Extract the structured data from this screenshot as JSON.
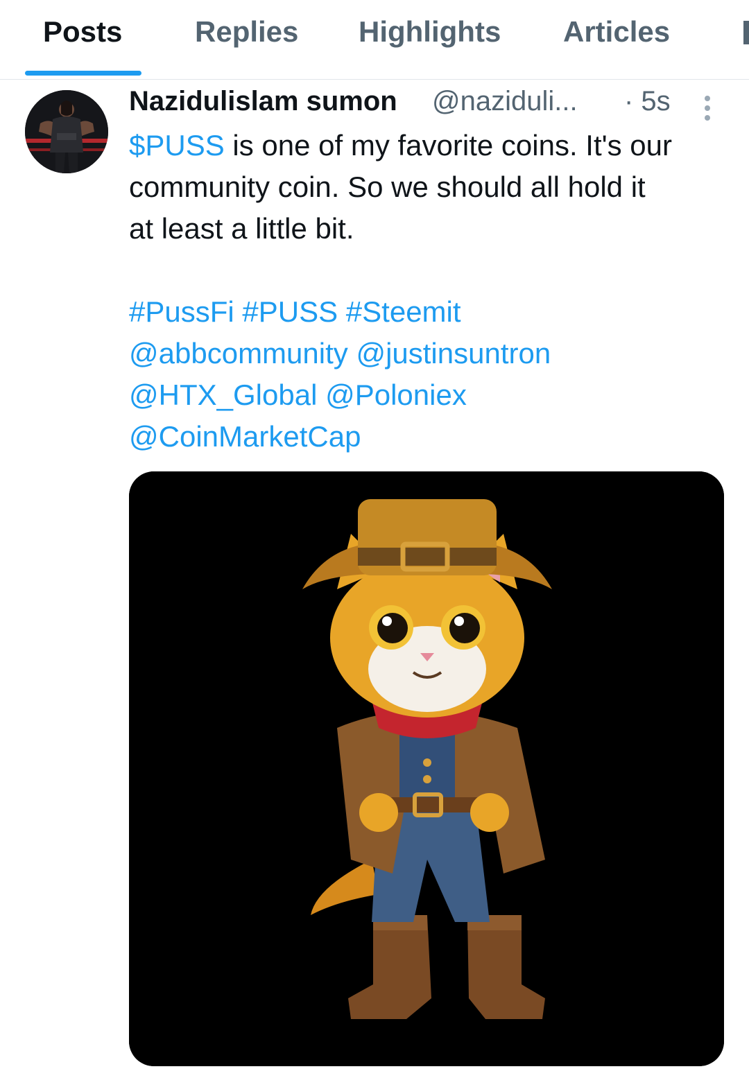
{
  "tabs": [
    {
      "label": "Posts",
      "active": true
    },
    {
      "label": "Replies",
      "active": false
    },
    {
      "label": "Highlights",
      "active": false
    },
    {
      "label": "Articles",
      "active": false
    }
  ],
  "post": {
    "author_name": "Nazidulislam sumon",
    "author_handle": "@naziduli...",
    "timestamp": "· 5s",
    "cashtag": "$PUSS",
    "text_line1_rest": " is one of my favorite coins. It's our",
    "text_line2": "community coin. So we should all hold it",
    "text_line3": "at least a little bit.",
    "hashtags": [
      "#PussFi",
      "#PUSS",
      "#Steemit"
    ],
    "mentions_line1": [
      "@abbcommunity",
      "@justinsuntron"
    ],
    "mentions_line2": [
      "@HTX_Global",
      "@Poloniex"
    ],
    "mentions_line3": [
      "@CoinMarketCap"
    ],
    "media_description": "cartoon cat in cowboy outfit"
  },
  "colors": {
    "link": "#1d9bf0",
    "secondary_text": "#536471",
    "primary_text": "#0f1419"
  }
}
